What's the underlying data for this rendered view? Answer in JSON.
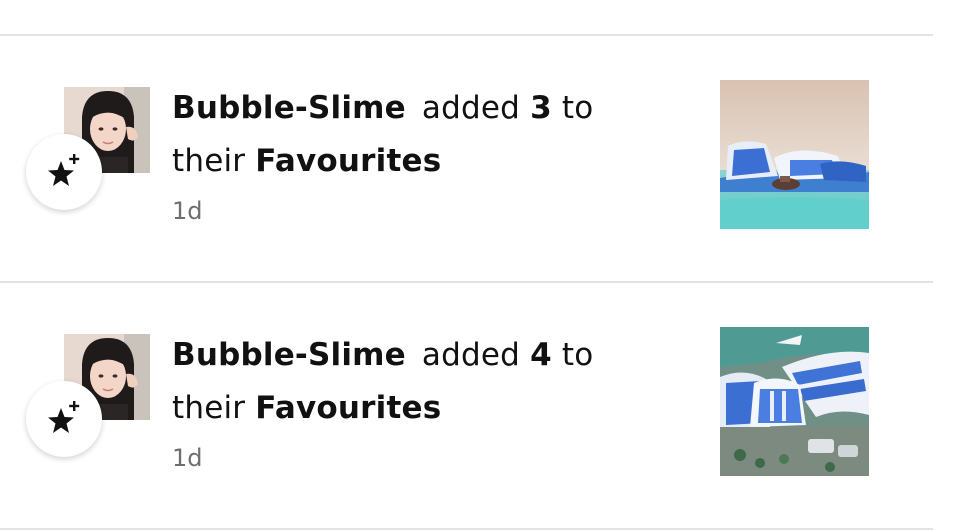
{
  "feed": {
    "items": [
      {
        "user": "Bubble-Slime",
        "action_prefix": "added",
        "count": "3",
        "action_suffix": "to",
        "line2_prefix": "their",
        "collection": "Favourites",
        "time": "1d",
        "badge_icon": "star-plus-icon"
      },
      {
        "user": "Bubble-Slime",
        "action_prefix": "added",
        "count": "4",
        "action_suffix": "to",
        "line2_prefix": "their",
        "collection": "Favourites",
        "time": "1d",
        "badge_icon": "star-plus-icon"
      }
    ]
  },
  "colors": {
    "divider": "#e3e3e3",
    "timestamp": "#6f6f6f",
    "text": "#111111"
  }
}
